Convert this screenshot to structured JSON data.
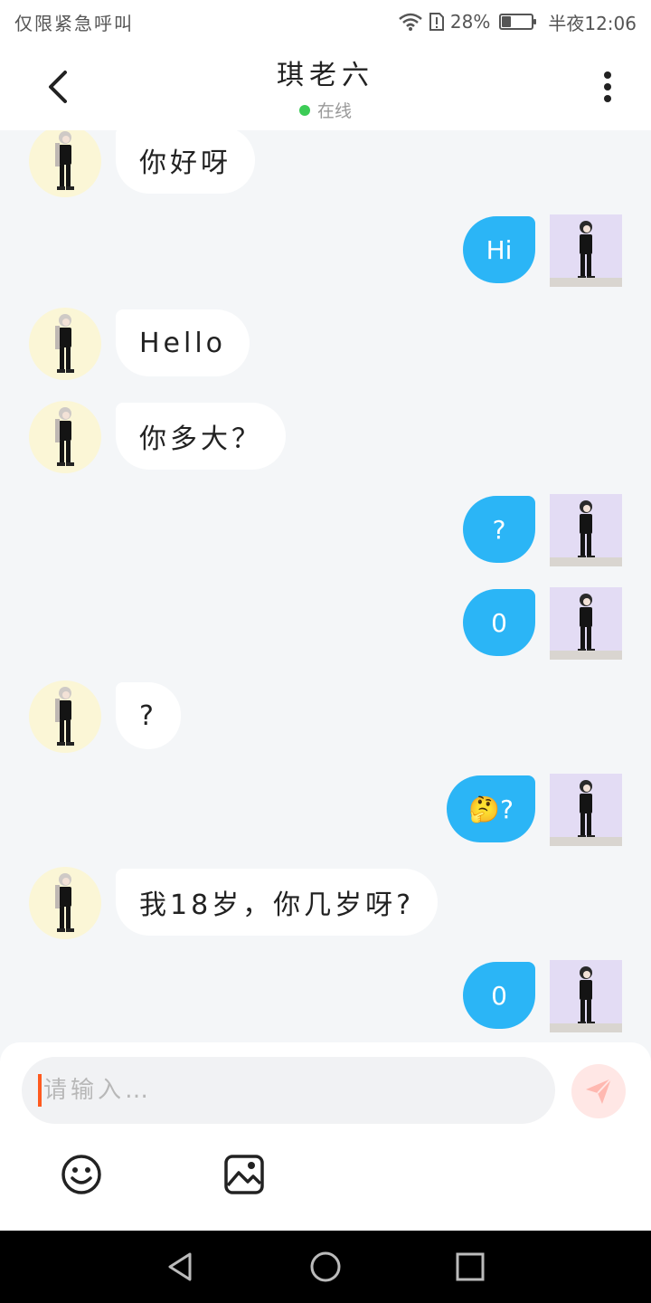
{
  "status_bar": {
    "left_text": "仅限紧急呼叫",
    "battery_percent": "28%",
    "time": "半夜12:06",
    "battery_level": 0.28
  },
  "header": {
    "title": "琪老六",
    "presence": "在线"
  },
  "messages": [
    {
      "side": "in",
      "text": "你好呀",
      "top": 0
    },
    {
      "side": "out",
      "text": "Hi"
    },
    {
      "side": "in",
      "text": "Hello"
    },
    {
      "side": "in",
      "text": "你多大？"
    },
    {
      "side": "out",
      "text": "?"
    },
    {
      "side": "out",
      "text": "0"
    },
    {
      "side": "in",
      "text": "?"
    },
    {
      "side": "out",
      "text": "🤔?"
    },
    {
      "side": "in",
      "text": "我18岁，你几岁呀?"
    },
    {
      "side": "out",
      "text": "0"
    }
  ],
  "composer": {
    "placeholder": "请输入…"
  },
  "colors": {
    "accent": "#2bb5f6",
    "online": "#3ccc56",
    "caret": "#ff5a1f",
    "send": "#ffe7e5"
  },
  "icons": {
    "back": "chevron-left-icon",
    "more": "more-vertical-icon",
    "send": "send-icon",
    "emoji": "emoji-icon",
    "image": "image-icon"
  }
}
